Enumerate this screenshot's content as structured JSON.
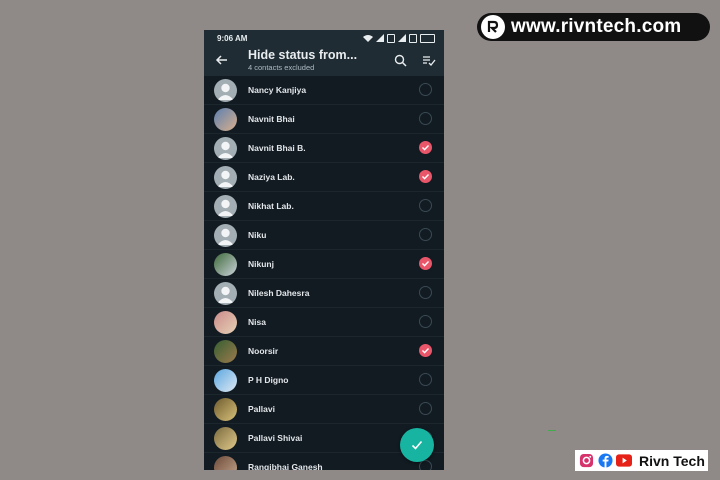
{
  "watermark": {
    "site": "www.rivntech.com",
    "channel": "Rivn Tech"
  },
  "status_bar": {
    "time": "9:06 AM"
  },
  "app_bar": {
    "title": "Hide status from...",
    "subtitle": "4 contacts excluded",
    "icons": [
      "back-arrow-icon",
      "search-icon",
      "select-all-icon"
    ]
  },
  "contacts": [
    {
      "name": "Nancy Kanjiya",
      "checked": false,
      "avatar": "default"
    },
    {
      "name": "Navnit Bhai",
      "checked": false,
      "avatar": "photo-a"
    },
    {
      "name": "Navnit Bhai B.",
      "checked": true,
      "avatar": "default"
    },
    {
      "name": "Naziya Lab.",
      "checked": true,
      "avatar": "default"
    },
    {
      "name": "Nikhat Lab.",
      "checked": false,
      "avatar": "default"
    },
    {
      "name": "Niku",
      "checked": false,
      "avatar": "default"
    },
    {
      "name": "Nikunj",
      "checked": true,
      "avatar": "photo-b"
    },
    {
      "name": "Nilesh Dahesra",
      "checked": false,
      "avatar": "default"
    },
    {
      "name": "Nisa",
      "checked": false,
      "avatar": "photo-c"
    },
    {
      "name": "Noorsir",
      "checked": true,
      "avatar": "photo-d"
    },
    {
      "name": "P H Digno",
      "checked": false,
      "avatar": "photo-e"
    },
    {
      "name": "Pallavi",
      "checked": false,
      "avatar": "photo-f"
    },
    {
      "name": "Pallavi Shivai",
      "checked": false,
      "avatar": "photo-g"
    },
    {
      "name": "Rangibhai Ganesh",
      "checked": false,
      "avatar": "photo-h"
    }
  ],
  "colors": {
    "check_on": "#e9566a",
    "fab": "#17b4a1",
    "app_bar": "#1f2c33",
    "list_bg": "#121b22"
  }
}
